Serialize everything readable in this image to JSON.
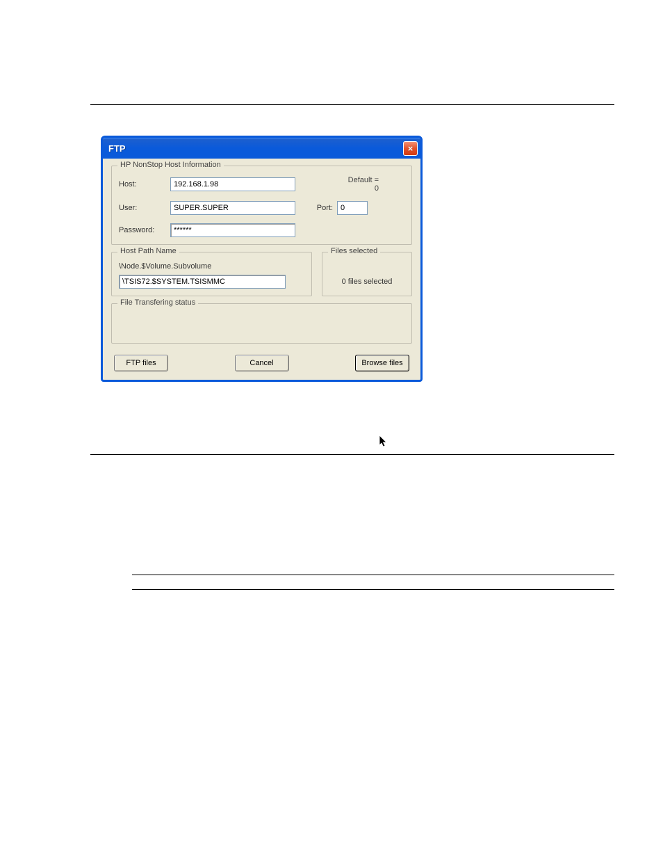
{
  "dialog": {
    "title": "FTP",
    "close_icon_glyph": "×"
  },
  "host_info": {
    "legend": "HP NonStop Host Information",
    "host_label": "Host:",
    "host_value": "192.168.1.98",
    "user_label": "User:",
    "user_value": "SUPER.SUPER",
    "password_label": "Password:",
    "password_value": "******",
    "default_note": "Default = 0",
    "port_label": "Port:",
    "port_value": "0"
  },
  "host_path": {
    "legend": "Host Path Name",
    "hint": "\\Node.$Volume.Subvolume",
    "value": "\\TSIS72.$SYSTEM.TSISMMC"
  },
  "files_selected": {
    "legend": "Files selected",
    "status": "0 files selected"
  },
  "transfer": {
    "legend": "File Transfering status"
  },
  "buttons": {
    "ftp_files": "FTP files",
    "cancel": "Cancel",
    "browse_files": "Browse files"
  }
}
